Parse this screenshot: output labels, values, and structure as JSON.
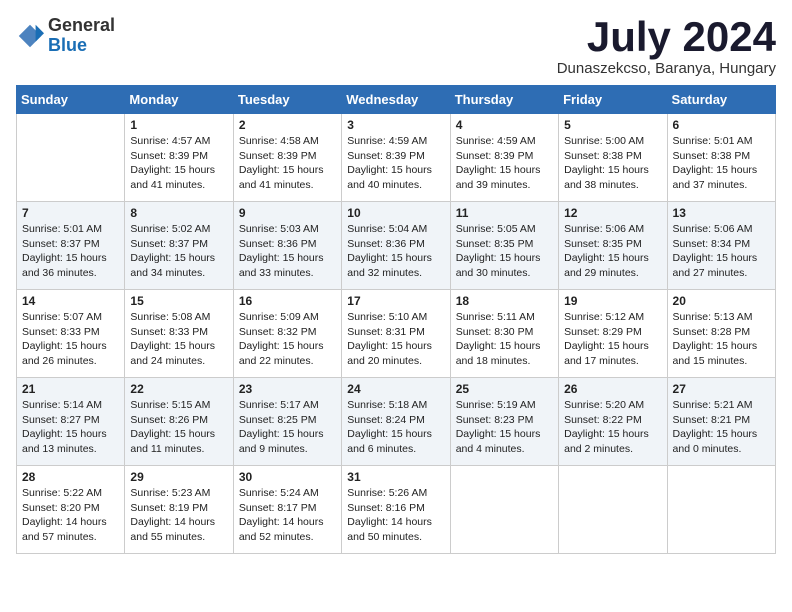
{
  "logo": {
    "general": "General",
    "blue": "Blue"
  },
  "header": {
    "month": "July 2024",
    "location": "Dunaszekcso, Baranya, Hungary"
  },
  "days_of_week": [
    "Sunday",
    "Monday",
    "Tuesday",
    "Wednesday",
    "Thursday",
    "Friday",
    "Saturday"
  ],
  "weeks": [
    [
      {
        "day": "",
        "info": ""
      },
      {
        "day": "1",
        "info": "Sunrise: 4:57 AM\nSunset: 8:39 PM\nDaylight: 15 hours\nand 41 minutes."
      },
      {
        "day": "2",
        "info": "Sunrise: 4:58 AM\nSunset: 8:39 PM\nDaylight: 15 hours\nand 41 minutes."
      },
      {
        "day": "3",
        "info": "Sunrise: 4:59 AM\nSunset: 8:39 PM\nDaylight: 15 hours\nand 40 minutes."
      },
      {
        "day": "4",
        "info": "Sunrise: 4:59 AM\nSunset: 8:39 PM\nDaylight: 15 hours\nand 39 minutes."
      },
      {
        "day": "5",
        "info": "Sunrise: 5:00 AM\nSunset: 8:38 PM\nDaylight: 15 hours\nand 38 minutes."
      },
      {
        "day": "6",
        "info": "Sunrise: 5:01 AM\nSunset: 8:38 PM\nDaylight: 15 hours\nand 37 minutes."
      }
    ],
    [
      {
        "day": "7",
        "info": "Sunrise: 5:01 AM\nSunset: 8:37 PM\nDaylight: 15 hours\nand 36 minutes."
      },
      {
        "day": "8",
        "info": "Sunrise: 5:02 AM\nSunset: 8:37 PM\nDaylight: 15 hours\nand 34 minutes."
      },
      {
        "day": "9",
        "info": "Sunrise: 5:03 AM\nSunset: 8:36 PM\nDaylight: 15 hours\nand 33 minutes."
      },
      {
        "day": "10",
        "info": "Sunrise: 5:04 AM\nSunset: 8:36 PM\nDaylight: 15 hours\nand 32 minutes."
      },
      {
        "day": "11",
        "info": "Sunrise: 5:05 AM\nSunset: 8:35 PM\nDaylight: 15 hours\nand 30 minutes."
      },
      {
        "day": "12",
        "info": "Sunrise: 5:06 AM\nSunset: 8:35 PM\nDaylight: 15 hours\nand 29 minutes."
      },
      {
        "day": "13",
        "info": "Sunrise: 5:06 AM\nSunset: 8:34 PM\nDaylight: 15 hours\nand 27 minutes."
      }
    ],
    [
      {
        "day": "14",
        "info": "Sunrise: 5:07 AM\nSunset: 8:33 PM\nDaylight: 15 hours\nand 26 minutes."
      },
      {
        "day": "15",
        "info": "Sunrise: 5:08 AM\nSunset: 8:33 PM\nDaylight: 15 hours\nand 24 minutes."
      },
      {
        "day": "16",
        "info": "Sunrise: 5:09 AM\nSunset: 8:32 PM\nDaylight: 15 hours\nand 22 minutes."
      },
      {
        "day": "17",
        "info": "Sunrise: 5:10 AM\nSunset: 8:31 PM\nDaylight: 15 hours\nand 20 minutes."
      },
      {
        "day": "18",
        "info": "Sunrise: 5:11 AM\nSunset: 8:30 PM\nDaylight: 15 hours\nand 18 minutes."
      },
      {
        "day": "19",
        "info": "Sunrise: 5:12 AM\nSunset: 8:29 PM\nDaylight: 15 hours\nand 17 minutes."
      },
      {
        "day": "20",
        "info": "Sunrise: 5:13 AM\nSunset: 8:28 PM\nDaylight: 15 hours\nand 15 minutes."
      }
    ],
    [
      {
        "day": "21",
        "info": "Sunrise: 5:14 AM\nSunset: 8:27 PM\nDaylight: 15 hours\nand 13 minutes."
      },
      {
        "day": "22",
        "info": "Sunrise: 5:15 AM\nSunset: 8:26 PM\nDaylight: 15 hours\nand 11 minutes."
      },
      {
        "day": "23",
        "info": "Sunrise: 5:17 AM\nSunset: 8:25 PM\nDaylight: 15 hours\nand 9 minutes."
      },
      {
        "day": "24",
        "info": "Sunrise: 5:18 AM\nSunset: 8:24 PM\nDaylight: 15 hours\nand 6 minutes."
      },
      {
        "day": "25",
        "info": "Sunrise: 5:19 AM\nSunset: 8:23 PM\nDaylight: 15 hours\nand 4 minutes."
      },
      {
        "day": "26",
        "info": "Sunrise: 5:20 AM\nSunset: 8:22 PM\nDaylight: 15 hours\nand 2 minutes."
      },
      {
        "day": "27",
        "info": "Sunrise: 5:21 AM\nSunset: 8:21 PM\nDaylight: 15 hours\nand 0 minutes."
      }
    ],
    [
      {
        "day": "28",
        "info": "Sunrise: 5:22 AM\nSunset: 8:20 PM\nDaylight: 14 hours\nand 57 minutes."
      },
      {
        "day": "29",
        "info": "Sunrise: 5:23 AM\nSunset: 8:19 PM\nDaylight: 14 hours\nand 55 minutes."
      },
      {
        "day": "30",
        "info": "Sunrise: 5:24 AM\nSunset: 8:17 PM\nDaylight: 14 hours\nand 52 minutes."
      },
      {
        "day": "31",
        "info": "Sunrise: 5:26 AM\nSunset: 8:16 PM\nDaylight: 14 hours\nand 50 minutes."
      },
      {
        "day": "",
        "info": ""
      },
      {
        "day": "",
        "info": ""
      },
      {
        "day": "",
        "info": ""
      }
    ]
  ]
}
